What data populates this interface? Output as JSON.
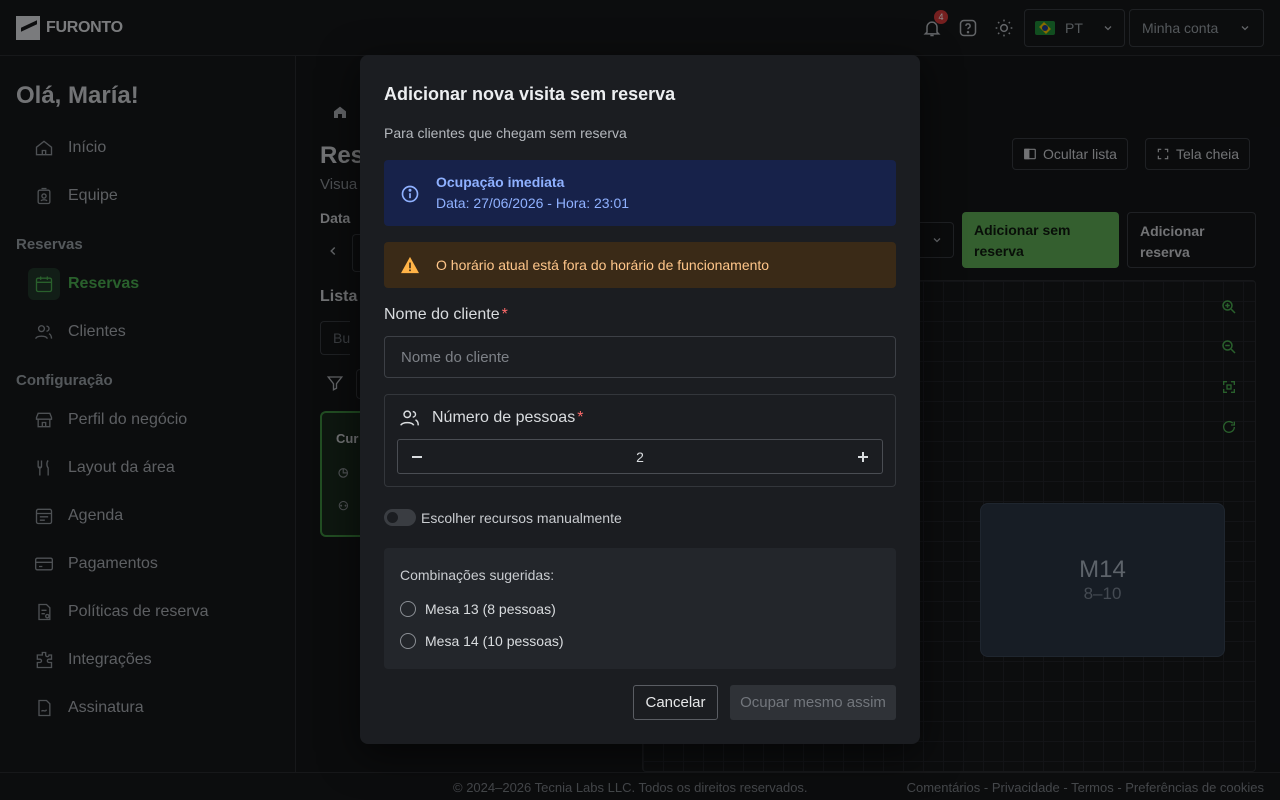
{
  "header": {
    "brand": "FURONTO",
    "notifications_count": "4",
    "language": "PT",
    "account_label": "Minha conta"
  },
  "sidebar": {
    "greeting": "Olá, María!",
    "items": {
      "inicio": "Início",
      "equipe": "Equipe",
      "reservas": "Reservas",
      "clientes": "Clientes",
      "perfil": "Perfil do negócio",
      "layout": "Layout da área",
      "agenda": "Agenda",
      "pagamentos": "Pagamentos",
      "politicas": "Políticas de reserva",
      "integracoes": "Integrações",
      "assinatura": "Assinatura"
    },
    "sections": {
      "reservas": "Reservas",
      "configuracao": "Configuração"
    }
  },
  "main": {
    "title_partial": "Res",
    "subtitle_partial": "Visua",
    "date_label": "Data",
    "list_label_partial": "Lista",
    "search_placeholder_partial": "Busc",
    "card_title_partial": "Cur",
    "hide_list_label": "Ocultar lista",
    "fullscreen_label": "Tela cheia",
    "add_walkin_label": "Adicionar sem reserva",
    "add_reservation_label": "Adicionar reserva",
    "table": {
      "name": "M14",
      "capacity": "8–10"
    }
  },
  "modal": {
    "title": "Adicionar nova visita sem reserva",
    "subtitle": "Para clientes que chegam sem reserva",
    "info_title": "Ocupação imediata",
    "info_text": "Data: 27/06/2026 - Hora: 23:01",
    "warning_text": "O horário atual está fora do horário de funcionamento",
    "client_name_label": "Nome do cliente",
    "client_name_placeholder": "Nome do cliente",
    "client_name_value": "",
    "required_mark": "*",
    "people_label": "Número de pessoas",
    "people_value": "2",
    "manual_toggle_label": "Escolher recursos manualmente",
    "manual_toggle_on": false,
    "combos_title": "Combinações sugeridas:",
    "combos": [
      "Mesa 13 (8 pessoas)",
      "Mesa 14 (10 pessoas)"
    ],
    "cancel_label": "Cancelar",
    "occupy_label": "Ocupar mesmo assim"
  },
  "footer": {
    "copyright": "© 2024–2026 Tecnia Labs LLC. Todos os direitos reservados.",
    "links": "Comentários - Privacidade - Termos - Preferências de cookies"
  },
  "colors": {
    "accent_green": "#4caf50",
    "info_bg": "#17224a",
    "warning_bg": "#3a2a17",
    "required_red": "#ff6b6b"
  }
}
